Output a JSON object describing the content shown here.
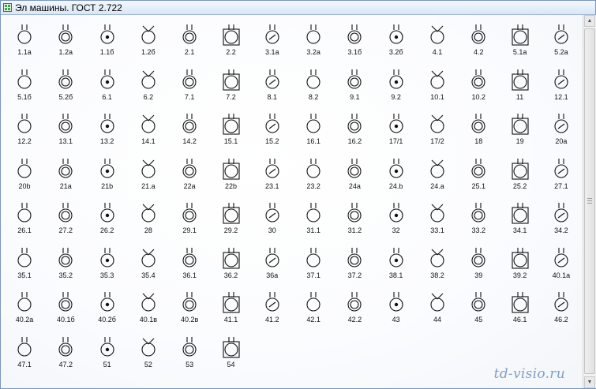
{
  "window": {
    "title": "Эл машины. ГОСТ 2.722",
    "icon": "spreadsheet-icon"
  },
  "watermark": "td-visio.ru",
  "scrollbar": {
    "up": "▲",
    "down": "▼"
  },
  "rows": [
    [
      "1.1а",
      "1.2а",
      "1.1б",
      "1.2б",
      "2.1",
      "2.2",
      "3.1а",
      "3.2а",
      "3.1б",
      "3.2б",
      "4.1",
      "4.2",
      "5.1а",
      "5.2а"
    ],
    [
      "5.1б",
      "5.2б",
      "6.1",
      "6.2",
      "7.1",
      "7.2",
      "8.1",
      "8.2",
      "9.1",
      "9.2",
      "10.1",
      "10.2",
      "11",
      "12.1"
    ],
    [
      "12.2",
      "13.1",
      "13.2",
      "14.1",
      "14.2",
      "15.1",
      "15.2",
      "16.1",
      "16.2",
      "17/1",
      "17/2",
      "18",
      "19",
      "20а"
    ],
    [
      "20b",
      "21а",
      "21b",
      "21.а",
      "22а",
      "22b",
      "23.1",
      "23.2",
      "24а",
      "24.b",
      "24.а",
      "25.1",
      "25.2",
      "27.1"
    ],
    [
      "26.1",
      "27.2",
      "26.2",
      "28",
      "29.1",
      "29.2",
      "30",
      "31.1",
      "31.2",
      "32",
      "33.1",
      "33.2",
      "34.1",
      "34.2"
    ],
    [
      "35.1",
      "35.2",
      "35.3",
      "35.4",
      "36.1",
      "36.2",
      "36а",
      "37.1",
      "37.2",
      "38.1",
      "38.2",
      "39",
      "39.2",
      "40.1а"
    ],
    [
      "40.2а",
      "40.1б",
      "40.2б",
      "40.1в",
      "40.2в",
      "41.1",
      "41.2",
      "42.1",
      "42.2",
      "43",
      "44",
      "45",
      "46.1",
      "46.2"
    ],
    [
      "47.1",
      "47.2",
      "51",
      "52",
      "53",
      "54"
    ]
  ]
}
